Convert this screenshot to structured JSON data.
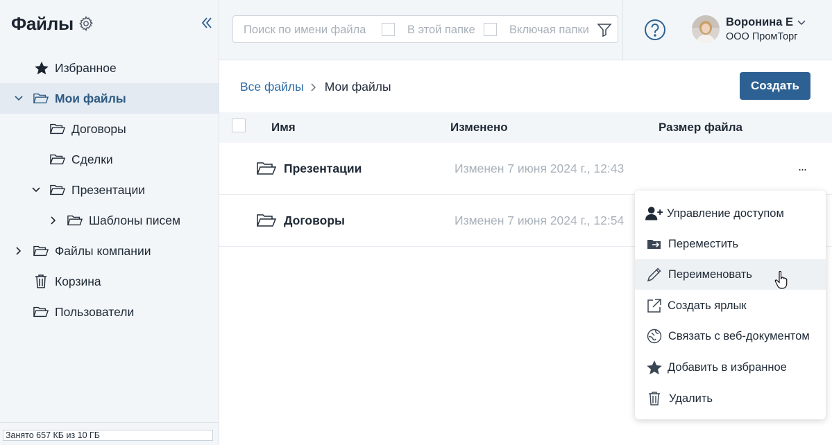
{
  "sidebar": {
    "title": "Файлы",
    "items": [
      {
        "label": "Избранное",
        "icon": "star-icon"
      },
      {
        "label": "Мои файлы",
        "icon": "folder-open-icon",
        "expanded": true,
        "active": true
      },
      {
        "label": "Договоры",
        "icon": "folder-open-icon"
      },
      {
        "label": "Сделки",
        "icon": "folder-open-icon"
      },
      {
        "label": "Презентации",
        "icon": "folder-open-icon",
        "expanded": true
      },
      {
        "label": "Шаблоны писем",
        "icon": "folder-open-icon",
        "expanded": false
      },
      {
        "label": "Файлы компании",
        "icon": "folder-open-icon",
        "expanded": false
      },
      {
        "label": "Корзина",
        "icon": "trash-icon"
      },
      {
        "label": "Пользователи",
        "icon": "folder-open-icon"
      }
    ],
    "storage": {
      "text": "Занято 657 КБ из 10 ГБ",
      "used_fraction": 0.0001
    }
  },
  "search": {
    "placeholder": "Поиск по имени файла",
    "option_this_folder": "В этой папке",
    "option_include_folders": "Включая папки"
  },
  "user": {
    "name": "Воронина Е",
    "org": "ООО ПромТорг"
  },
  "breadcrumb": {
    "root": "Все файлы",
    "current": "Мои файлы"
  },
  "toolbar": {
    "create_label": "Создать"
  },
  "table": {
    "columns": [
      "Имя",
      "Изменено",
      "Размер файла"
    ],
    "rows": [
      {
        "name": "Презентации",
        "modified": "Изменен 7 июня 2024 г., 12:43",
        "more": "..."
      },
      {
        "name": "Договоры",
        "modified": "Изменен 7 июня 2024 г., 12:54"
      }
    ]
  },
  "context_menu": {
    "items": [
      {
        "label": "Управление доступом",
        "icon": "user-add-icon"
      },
      {
        "label": "Переместить",
        "icon": "move-folder-icon"
      },
      {
        "label": "Переименовать",
        "icon": "pencil-icon",
        "hovered": true
      },
      {
        "label": "Создать ярлык",
        "icon": "shortcut-icon"
      },
      {
        "label": "Связать с веб-документом",
        "icon": "web-link-icon"
      },
      {
        "label": "Добавить в избранное",
        "icon": "star-icon"
      },
      {
        "label": "Удалить",
        "icon": "trash-icon"
      }
    ]
  },
  "colors": {
    "accent": "#2d6193",
    "link": "#2d6da8",
    "sidebar_bg": "#f3f6f9",
    "active_bg": "#e3eaf1"
  }
}
